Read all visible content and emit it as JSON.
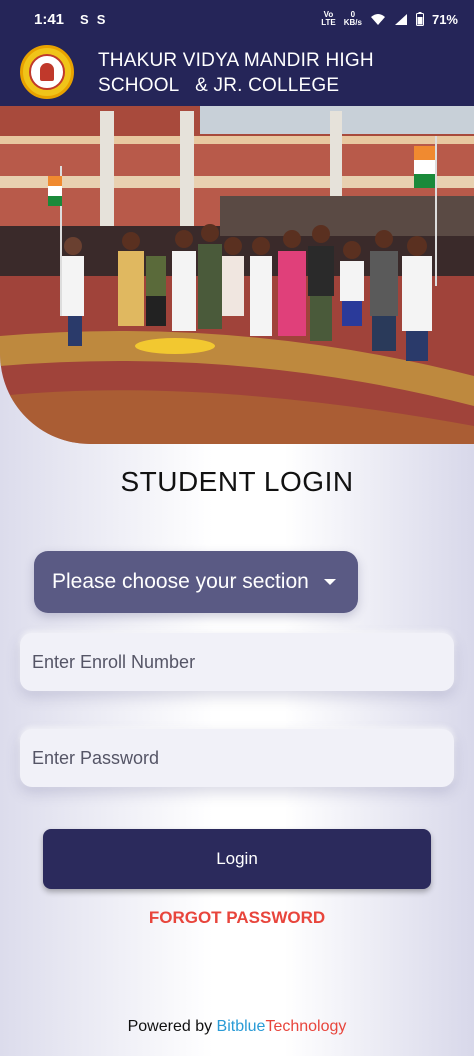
{
  "status_bar": {
    "time": "1:41",
    "notification_icons": [
      "S",
      "S"
    ],
    "network_label_top": "Vo",
    "network_label_bottom": "LTE",
    "speed_top": "0",
    "speed_bottom": "KB/s",
    "battery_percent": "71%"
  },
  "header": {
    "school_name_line1": "THAKUR VIDYA MANDIR HIGH",
    "school_name_line2": "SCHOOL   & JR. COLLEGE"
  },
  "login": {
    "title": "STUDENT LOGIN",
    "section_select": {
      "value": "Please choose your section"
    },
    "enroll_placeholder": "Enter Enroll Number",
    "password_placeholder": "Enter Password",
    "login_label": "Login",
    "forgot_label": "FORGOT PASSWORD"
  },
  "footer": {
    "powered_prefix": "Powered by ",
    "brand_part1": "Bitblue",
    "brand_part2": "Technology"
  },
  "colors": {
    "primary": "#252558",
    "select_bg": "#5a5a84",
    "forgot": "#e8453c",
    "brand_blue": "#2a9bd6",
    "brand_red": "#e8453c"
  }
}
